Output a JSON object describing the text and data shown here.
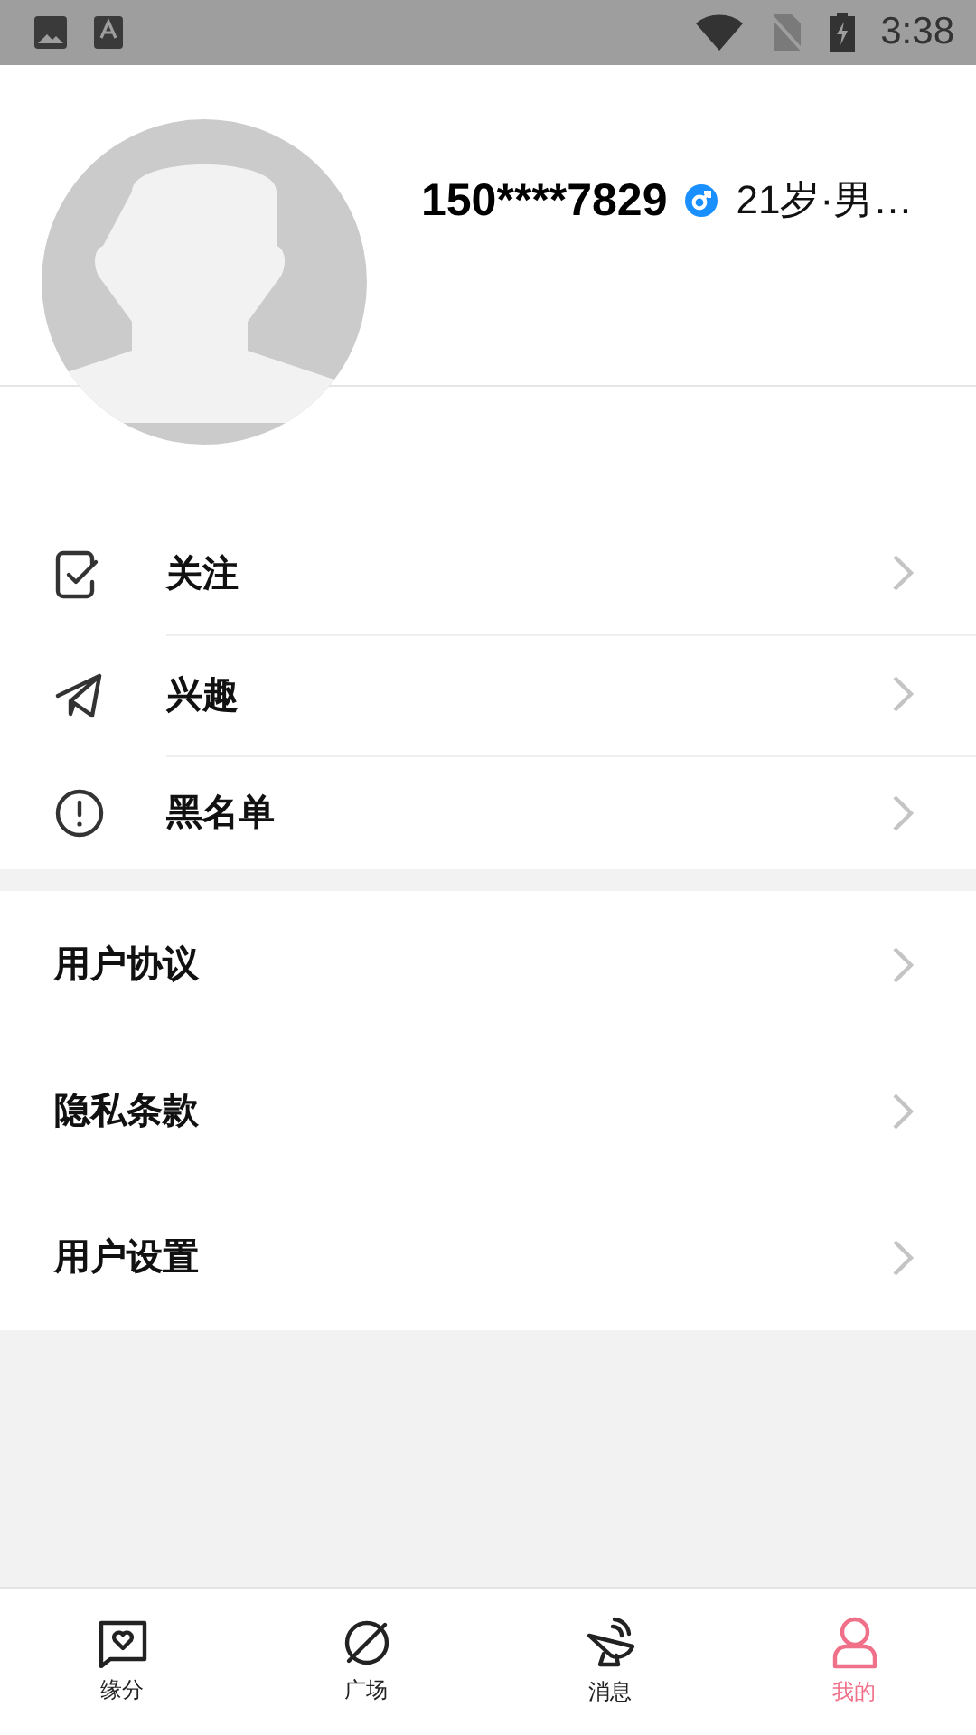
{
  "status_bar": {
    "time": "3:38"
  },
  "profile": {
    "name": "150****7829",
    "info": "21岁·男…"
  },
  "menu_primary": [
    {
      "kind": "follow",
      "label": "关注"
    },
    {
      "kind": "interest",
      "label": "兴趣"
    },
    {
      "kind": "blacklist",
      "label": "黑名单"
    }
  ],
  "menu_secondary": [
    {
      "label": "用户协议"
    },
    {
      "label": "隐私条款"
    },
    {
      "label": "用户设置"
    }
  ],
  "tab_bar": [
    {
      "kind": "match",
      "label": "缘分",
      "selected": false
    },
    {
      "kind": "square",
      "label": "广场",
      "selected": false
    },
    {
      "kind": "messages",
      "label": "消息",
      "selected": false
    },
    {
      "kind": "me",
      "label": "我的",
      "selected": true
    }
  ]
}
